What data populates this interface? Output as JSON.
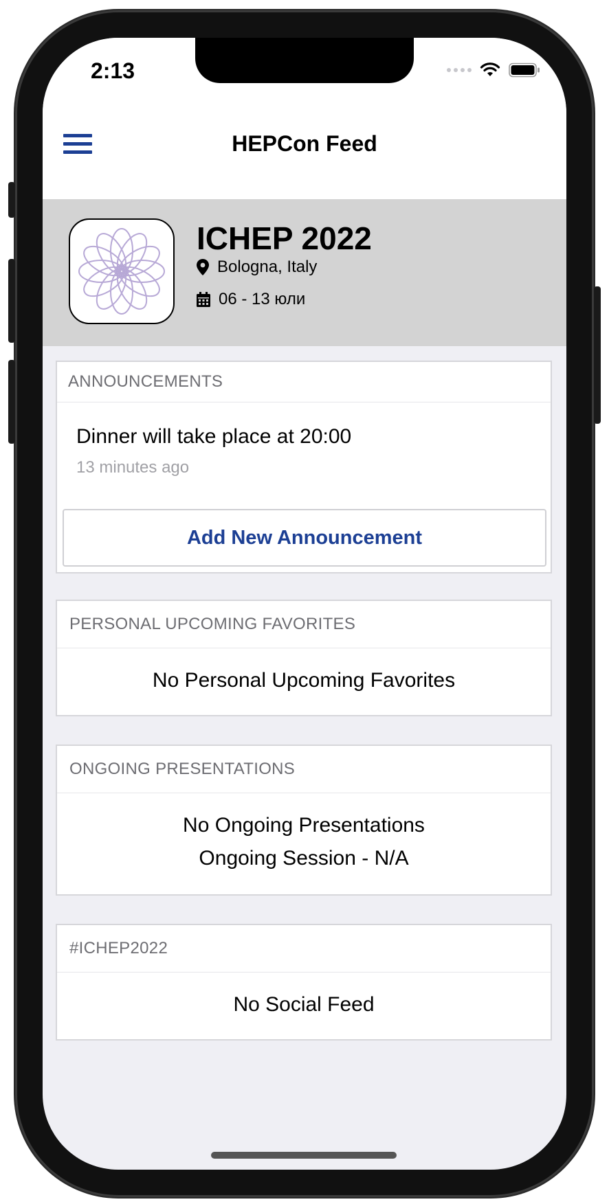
{
  "status_bar": {
    "time": "2:13"
  },
  "nav": {
    "title": "HEPCon Feed"
  },
  "event": {
    "name": "ICHEP 2022",
    "location": "Bologna, Italy",
    "dates": "06 - 13 юли"
  },
  "announcements": {
    "header": "ANNOUNCEMENTS",
    "items": [
      {
        "text": "Dinner will take place at 20:00",
        "time": "13 minutes ago"
      }
    ],
    "add_button": "Add New Announcement"
  },
  "favorites": {
    "header": "PERSONAL UPCOMING FAVORITES",
    "empty": "No Personal Upcoming Favorites"
  },
  "ongoing": {
    "header": "ONGOING PRESENTATIONS",
    "empty": "No Ongoing Presentations",
    "session": "Ongoing Session - N/A"
  },
  "social": {
    "header": "#ICHEP2022",
    "empty": "No Social Feed"
  },
  "colors": {
    "accent": "#1c3f94",
    "header_bg": "#d3d3d3",
    "page_bg": "#efeff4",
    "logo_stroke": "#b7a8d6"
  }
}
